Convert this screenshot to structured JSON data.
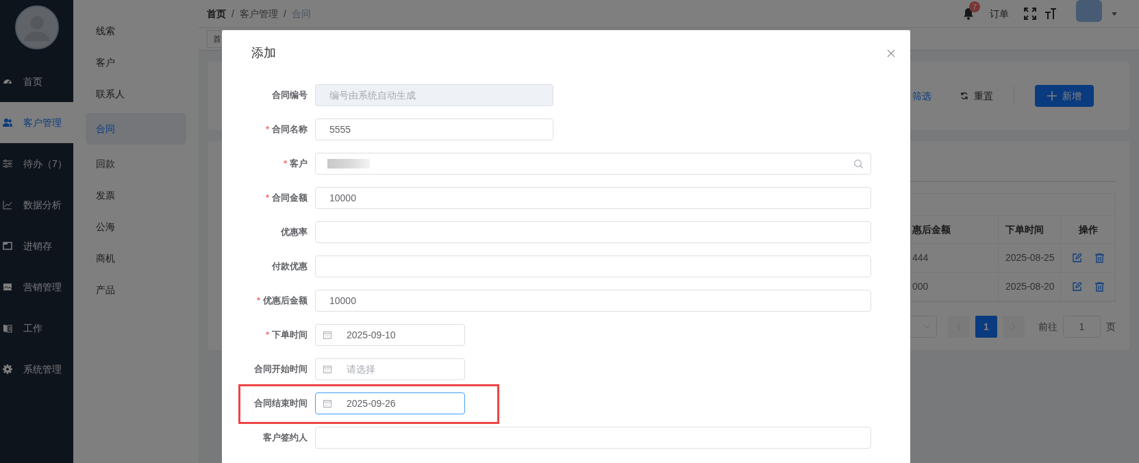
{
  "sidebar": {
    "items": [
      {
        "label": "首页",
        "selected": false
      },
      {
        "label": "客户管理",
        "selected": true
      },
      {
        "label": "待办（7）",
        "selected": false
      },
      {
        "label": "数据分析",
        "selected": false
      },
      {
        "label": "进销存",
        "selected": false
      },
      {
        "label": "营销管理",
        "selected": false
      },
      {
        "label": "工作",
        "selected": false
      },
      {
        "label": "系统管理",
        "selected": false
      }
    ]
  },
  "submenu": {
    "items": [
      {
        "label": "线索",
        "selected": false
      },
      {
        "label": "客户",
        "selected": false
      },
      {
        "label": "联系人",
        "selected": false
      },
      {
        "label": "合同",
        "selected": true
      },
      {
        "label": "回款",
        "selected": false
      },
      {
        "label": "发票",
        "selected": false
      },
      {
        "label": "公海",
        "selected": false
      },
      {
        "label": "商机",
        "selected": false
      },
      {
        "label": "产品",
        "selected": false
      }
    ]
  },
  "breadcrumb": {
    "separator": "/",
    "items": [
      {
        "label": "首页",
        "current": false
      },
      {
        "label": "客户管理",
        "current": false
      },
      {
        "label": "合同",
        "current": true
      }
    ]
  },
  "header": {
    "notification_count": "7",
    "order_link": "订单"
  },
  "tabs_bar": {
    "tabs": [
      {
        "label": "首"
      }
    ]
  },
  "filter_bar": {
    "filter_link": "筛选",
    "reset_button": "重置",
    "add_button": "新增"
  },
  "table": {
    "columns": [
      "惠后金额",
      "下单时间",
      "操作"
    ],
    "rows": [
      [
        "444",
        "2025-08-25"
      ],
      [
        "000",
        "2025-08-20"
      ]
    ]
  },
  "pagination": {
    "pages": [
      {
        "label": "1",
        "selected": true
      }
    ],
    "goto_label": "前往",
    "goto_value": "1",
    "page_suffix": "页"
  },
  "dialog": {
    "title": "添加",
    "required_mark": "*",
    "fields": [
      {
        "label": "合同编号",
        "kind": "short",
        "required": false,
        "disabled": true,
        "focused": false,
        "highlighted": false,
        "redacted": false,
        "placeholder": "编号由系统自动生成"
      },
      {
        "label": "合同名称",
        "kind": "short",
        "required": true,
        "disabled": false,
        "focused": false,
        "highlighted": false,
        "redacted": false,
        "value": "5555"
      },
      {
        "label": "客户",
        "kind": "search",
        "required": true,
        "disabled": false,
        "focused": false,
        "highlighted": false,
        "redacted": true
      },
      {
        "label": "合同金额",
        "kind": "text",
        "required": true,
        "disabled": false,
        "focused": false,
        "highlighted": false,
        "redacted": false,
        "value": "10000"
      },
      {
        "label": "优惠率",
        "kind": "text",
        "required": false,
        "disabled": false,
        "focused": false,
        "highlighted": false,
        "redacted": false
      },
      {
        "label": "付款优惠",
        "kind": "text",
        "required": false,
        "disabled": false,
        "focused": false,
        "highlighted": false,
        "redacted": false
      },
      {
        "label": "优惠后金额",
        "kind": "text",
        "required": true,
        "disabled": false,
        "focused": false,
        "highlighted": false,
        "redacted": false,
        "value": "10000"
      },
      {
        "label": "下单时间",
        "kind": "date",
        "required": true,
        "disabled": false,
        "focused": false,
        "highlighted": false,
        "redacted": false,
        "value": "2025-09-10"
      },
      {
        "label": "合同开始时间",
        "kind": "date",
        "required": false,
        "disabled": false,
        "focused": false,
        "highlighted": false,
        "redacted": false,
        "placeholder": "请选择"
      },
      {
        "label": "合同结束时间",
        "kind": "date",
        "required": false,
        "disabled": false,
        "focused": true,
        "highlighted": true,
        "redacted": false,
        "value": "2025-09-26"
      },
      {
        "label": "客户签约人",
        "kind": "text",
        "required": false,
        "disabled": false,
        "focused": false,
        "highlighted": false,
        "redacted": false
      }
    ]
  }
}
